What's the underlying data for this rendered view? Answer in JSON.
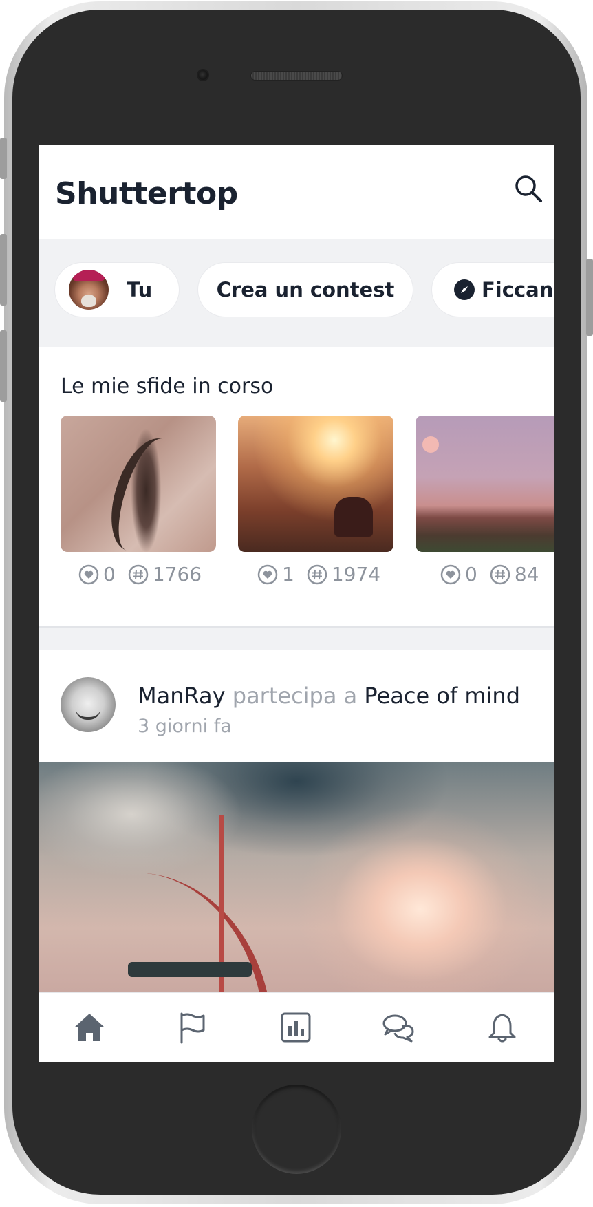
{
  "app": {
    "title": "Shuttertop"
  },
  "chips": {
    "you_label": "Tu",
    "create_contest_label": "Crea un contest",
    "explore_label": "Ficcanaso"
  },
  "challenges": {
    "section_title": "Le mie sfide in corso",
    "items": [
      {
        "likes": "0",
        "rank": "1766"
      },
      {
        "likes": "1",
        "rank": "1974"
      },
      {
        "likes": "0",
        "rank": "84"
      }
    ]
  },
  "feed": {
    "post": {
      "user": "ManRay",
      "action": "partecipa a",
      "contest": "Peace of mind",
      "time": "3 giorni fa"
    }
  },
  "icons": {
    "header": "search-icon",
    "tabs": [
      "home-icon",
      "flag-icon",
      "bar-chart-icon",
      "chat-icon",
      "bell-icon"
    ]
  },
  "colors": {
    "text_dark": "#1a2230",
    "text_muted": "#a0a5ad",
    "background_gray": "#f1f2f4",
    "tab_icon": "#5b6470"
  }
}
